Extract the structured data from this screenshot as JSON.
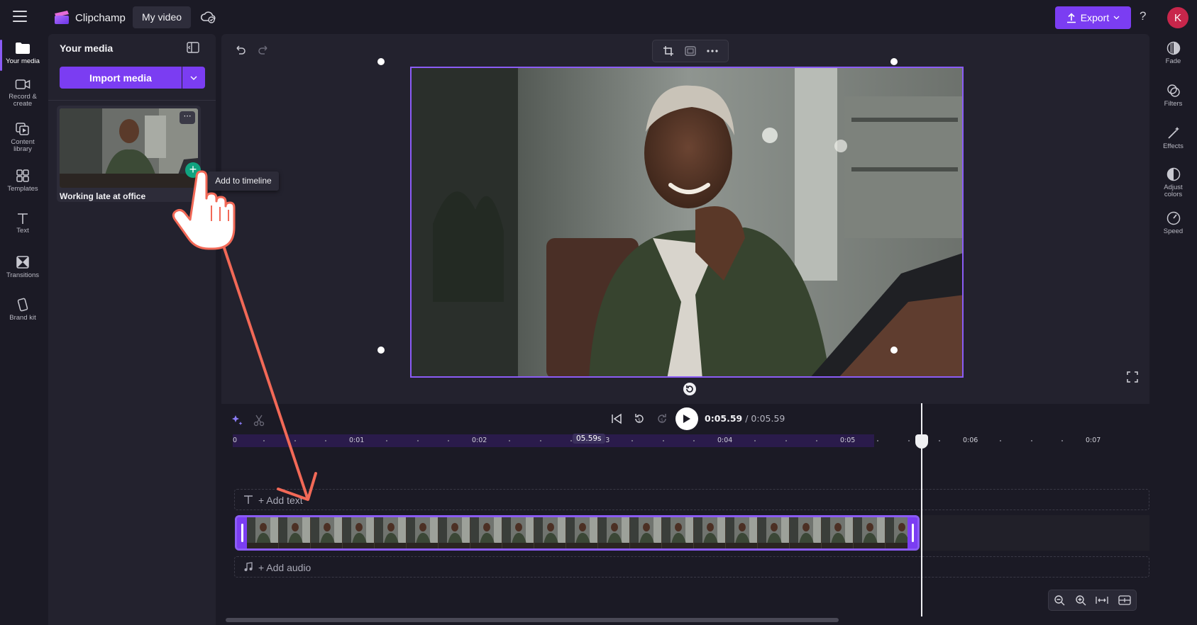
{
  "app": {
    "name": "Clipchamp",
    "project_title": "My video",
    "export_label": "Export",
    "help_label": "?",
    "avatar_initial": "K",
    "accent_color": "#7b3df2"
  },
  "left_rail": {
    "items": [
      {
        "label_lines": [
          "Your media"
        ],
        "icon": "folder-icon",
        "active": true
      },
      {
        "label_lines": [
          "Record &",
          "create"
        ],
        "icon": "camera-icon"
      },
      {
        "label_lines": [
          "Content",
          "library"
        ],
        "icon": "library-icon"
      },
      {
        "label_lines": [
          "Templates"
        ],
        "icon": "templates-icon"
      },
      {
        "label_lines": [
          "Text"
        ],
        "icon": "text-icon"
      },
      {
        "label_lines": [
          "Transitions"
        ],
        "icon": "transitions-icon"
      },
      {
        "label_lines": [
          "Brand kit"
        ],
        "icon": "brand-kit-icon"
      }
    ]
  },
  "media_panel": {
    "title": "Your media",
    "import_label": "Import media",
    "more_label": "⋯",
    "add_label": "+",
    "items": [
      {
        "name": "Working late at office",
        "tooltip": "Add to timeline"
      }
    ]
  },
  "right_rail": {
    "items": [
      {
        "label_lines": [
          "Fade"
        ],
        "icon": "fade-icon"
      },
      {
        "label_lines": [
          "Filters"
        ],
        "icon": "filters-icon"
      },
      {
        "label_lines": [
          "Effects"
        ],
        "icon": "effects-icon"
      },
      {
        "label_lines": [
          "Adjust",
          "colors"
        ],
        "icon": "adjust-colors-icon"
      },
      {
        "label_lines": [
          "Speed"
        ],
        "icon": "speed-icon"
      }
    ]
  },
  "timeline": {
    "current_time": "0:05.59",
    "separator": " / ",
    "total_time": "0:05.59",
    "cursor_time": "05.59s",
    "ticks": [
      "0",
      "0:01",
      "0:02",
      "0:03",
      "0:04",
      "0:05",
      "0:06",
      "0:07"
    ],
    "add_text_label": "+ Add text",
    "add_audio_label": "+ Add audio"
  }
}
